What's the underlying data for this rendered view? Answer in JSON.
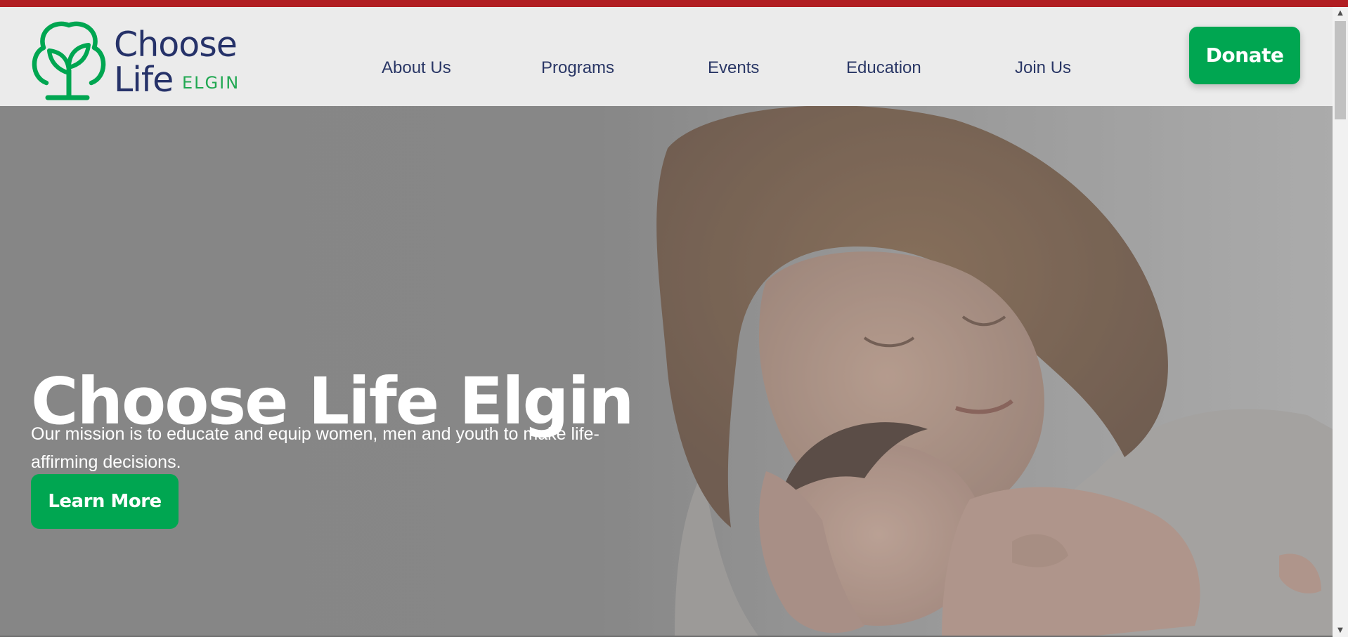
{
  "site": {
    "logo": {
      "line1": "Choose",
      "line2": "Life",
      "line3": "ELGIN",
      "icon": "tree-sprout-icon"
    },
    "nav": {
      "items": [
        {
          "label": "About Us"
        },
        {
          "label": "Programs"
        },
        {
          "label": "Events"
        },
        {
          "label": "Education"
        },
        {
          "label": "Join Us"
        }
      ]
    },
    "donate_label": "Donate"
  },
  "hero": {
    "title": "Choose Life Elgin",
    "subtitle": "Our mission is to educate and equip women, men and youth to make life-affirming decisions.",
    "cta_label": "Learn More",
    "image": "mother-holding-newborn-photo"
  },
  "colors": {
    "accent_green": "#00a651",
    "navy": "#263269",
    "top_strip": "#b11e22",
    "header_bg": "#ebebeb",
    "hero_overlay": "#8c8c8c"
  }
}
